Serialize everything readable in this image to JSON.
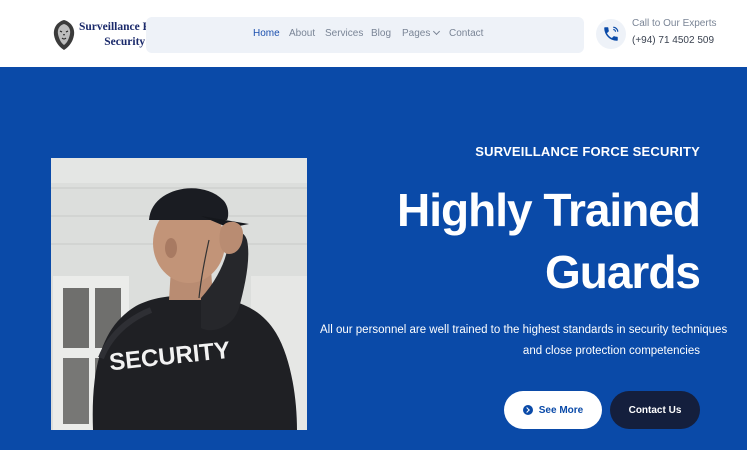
{
  "brand": {
    "name_line1": "Surveillance Force",
    "name_line2": "Security",
    "logo_icon": "lion-head-icon"
  },
  "nav": {
    "items": [
      {
        "label": "Home",
        "active": true
      },
      {
        "label": "About",
        "active": false
      },
      {
        "label": "Services",
        "active": false
      },
      {
        "label": "Blog",
        "active": false
      },
      {
        "label": "Pages",
        "active": false,
        "has_dropdown": true
      },
      {
        "label": "Contact",
        "active": false
      }
    ]
  },
  "call": {
    "icon": "phone-icon",
    "label": "Call to Our Experts",
    "number": "(+94) 71 4502 509"
  },
  "hero": {
    "eyebrow": "SURVEILLANCE FORCE SECURITY",
    "headline_line1": "Highly Trained",
    "headline_line2": "Guards",
    "description_line1": "All our personnel are well trained to the highest standards in security techniques",
    "description_line2": "and close protection competencies",
    "jacket_text": "SECURITY",
    "cta_primary": "See More",
    "cta_secondary": "Contact Us"
  },
  "colors": {
    "accent_blue": "#0a4aa8",
    "dark_navy": "#141f3d",
    "nav_bg": "#eef2f8",
    "nav_active": "#1a4fae"
  }
}
